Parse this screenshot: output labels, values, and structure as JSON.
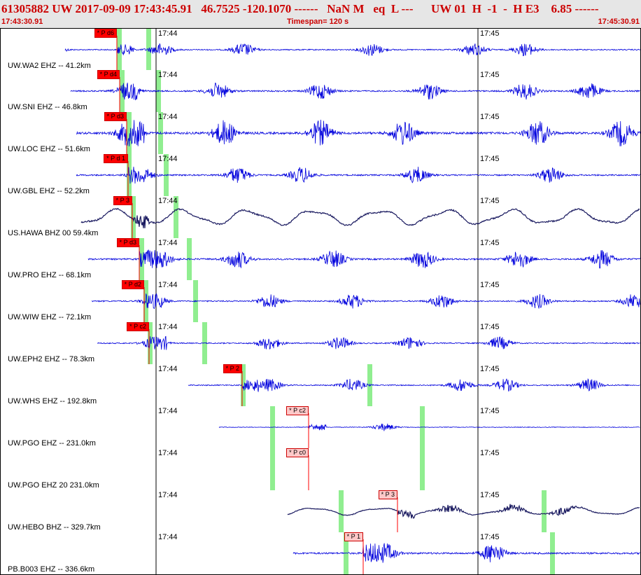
{
  "header": {
    "title": "61305882 UW 2017-09-09 17:43:45.91   46.7525 -120.1070 ------   NaN M   eq  L ---      UW 01  H  -1  -  H E3    6.85 ------",
    "start_time": "17:43:30.91",
    "timespan": "Timespan= 120 s",
    "end_time": "17:45:30.91"
  },
  "tick_labels": [
    "17:44",
    "17:45"
  ],
  "colors": {
    "trace_blue": "#0000dd",
    "trace_navy": "#1a1a60",
    "pick_red": "#ff0000",
    "pick_pink": "#ffc8c8",
    "window_green": "#90ee90"
  },
  "panels": [
    {
      "label": "UW.WA2 EHZ -- 41.2km",
      "pick": "* P d6",
      "pick_style": "primary",
      "color": "blue",
      "amp": 0.35,
      "bursts": [
        0.08,
        0.25,
        0.38,
        0.58,
        0.74,
        0.82
      ]
    },
    {
      "label": "UW.SNI EHZ -- 46.8km",
      "pick": "* P d4",
      "pick_style": "primary",
      "color": "blue",
      "amp": 0.45,
      "bursts": [
        0.2,
        0.34,
        0.5,
        0.67,
        0.82,
        0.92
      ]
    },
    {
      "label": "UW.LOC EHZ -- 51.6km",
      "pick": "* P d3",
      "pick_style": "primary",
      "color": "blue",
      "amp": 0.7,
      "bursts": [
        0.2,
        0.35,
        0.5,
        0.63,
        0.84,
        0.97
      ]
    },
    {
      "label": "UW.GBL EHZ -- 52.2km",
      "pick": "* P d 1",
      "pick_style": "primary",
      "color": "blue",
      "amp": 0.45,
      "bursts": [
        0.22,
        0.37,
        0.47,
        0.65,
        0.86
      ]
    },
    {
      "label": "US.HAWA BHZ 00 59.4km",
      "pick": "* P 3",
      "pick_style": "primary",
      "color": "navy",
      "amp": 0.6,
      "bursts": []
    },
    {
      "label": "UW.PRO EHZ -- 68.1km",
      "pick": "* P d3",
      "pick_style": "primary",
      "color": "blue",
      "amp": 0.5,
      "bursts": [
        0.25,
        0.37,
        0.52,
        0.66,
        0.81,
        0.94
      ]
    },
    {
      "label": "UW.WIW EHZ -- 72.1km",
      "pick": "* P d2",
      "pick_style": "primary",
      "color": "blue",
      "amp": 0.4,
      "bursts": [
        0.24,
        0.42,
        0.55,
        0.69,
        0.84,
        0.99
      ]
    },
    {
      "label": "UW.EPH2 EHZ -- 78.3km",
      "pick": "* P c2",
      "pick_style": "primary",
      "color": "blue",
      "amp": 0.35,
      "bursts": [
        0.24,
        0.42,
        0.53,
        0.64,
        0.78
      ]
    },
    {
      "label": "UW.WHS EHZ -- 192.8km",
      "pick": "* P 2",
      "pick_style": "primary",
      "color": "blue",
      "amp": 0.35,
      "bursts": [
        0.42,
        0.55,
        0.72,
        0.79,
        0.92
      ]
    },
    {
      "label": "UW.PGO EHZ -- 231.0km",
      "pick": "* P c2",
      "pick_style": "secondary",
      "color": "blue",
      "amp": 0.2,
      "bursts": [
        0.6
      ]
    },
    {
      "label": "UW.PGO EHZ 20 231.0km",
      "pick": "* P c0",
      "pick_style": "secondary",
      "color": "blue",
      "amp": 0.0,
      "bursts": []
    },
    {
      "label": "UW.HEBO BHZ -- 329.7km",
      "pick": "* P 3",
      "pick_style": "secondary",
      "color": "navy",
      "amp": 0.3,
      "bursts": [
        0.7,
        0.8,
        0.88
      ]
    },
    {
      "label": "PB.B003 EHZ -- 336.6km",
      "pick": "* P 1",
      "pick_style": "secondary",
      "color": "blue",
      "amp": 0.55,
      "bursts": [
        0.6,
        0.77
      ]
    }
  ]
}
